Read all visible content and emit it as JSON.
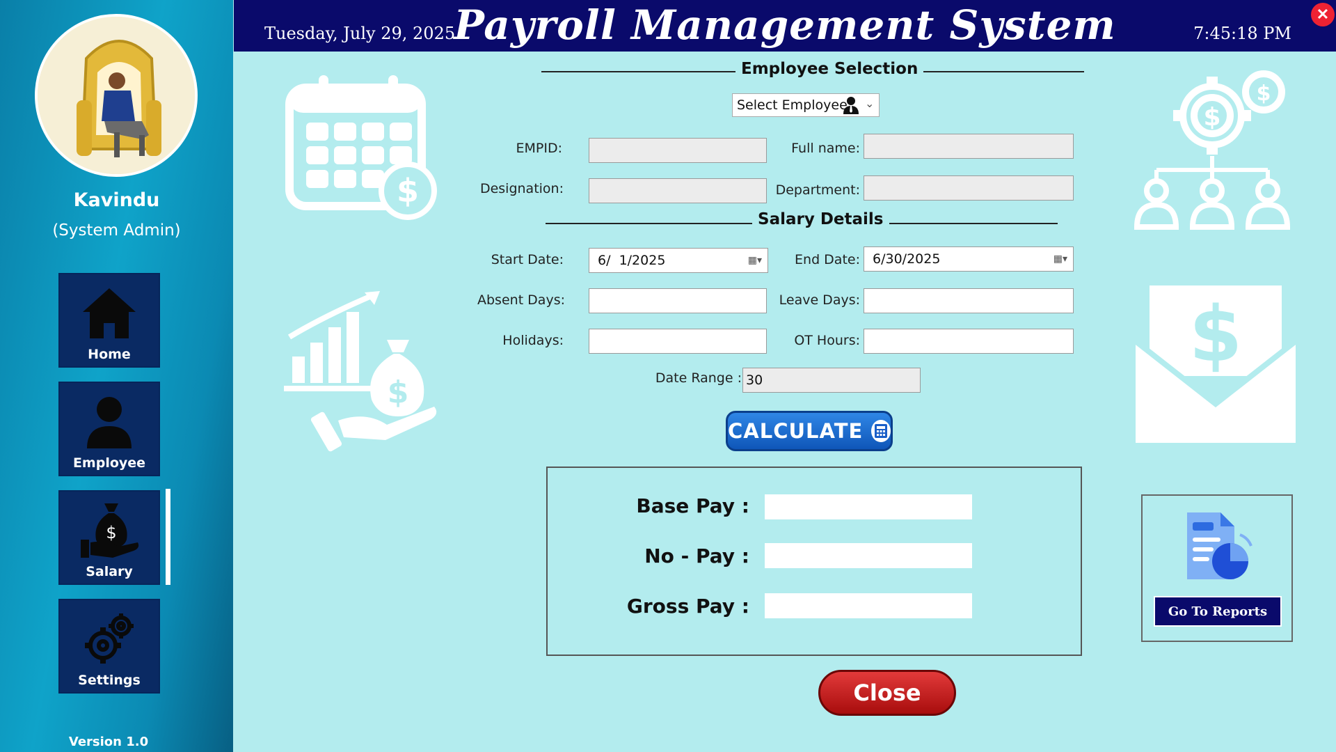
{
  "sidebar": {
    "user_name": "Kavindu",
    "user_role": "(System Admin)",
    "nav": [
      {
        "label": "Home",
        "icon": "home-icon"
      },
      {
        "label": "Employee",
        "icon": "user-icon"
      },
      {
        "label": "Salary",
        "icon": "money-bag-hand-icon"
      },
      {
        "label": "Settings",
        "icon": "gears-icon"
      }
    ],
    "active": "Salary",
    "version": "Version 1.0"
  },
  "header": {
    "date": "Tuesday, July 29, 2025",
    "title": "Payroll Management System",
    "time": "7:45:18 PM"
  },
  "employee_selection": {
    "title": "Employee Selection",
    "select_label": "Select Employee",
    "fields": {
      "empid_label": "EMPID:",
      "empid_value": "",
      "fullname_label": "Full name:",
      "fullname_value": "",
      "designation_label": "Designation:",
      "designation_value": "",
      "department_label": "Department:",
      "department_value": ""
    }
  },
  "salary_details": {
    "title": "Salary Details",
    "start_date_label": "Start Date:",
    "start_date_value": "6/  1/2025",
    "end_date_label": "End Date:",
    "end_date_value": "6/30/2025",
    "absent_label": "Absent Days:",
    "absent_value": "",
    "leave_label": "Leave Days:",
    "leave_value": "",
    "holidays_label": "Holidays:",
    "holidays_value": "",
    "ot_label": "OT Hours:",
    "ot_value": "",
    "range_label": "Date Range :",
    "range_value": "30"
  },
  "buttons": {
    "calculate": "CALCULATE",
    "close": "Close",
    "reports": "Go To Reports"
  },
  "pay": {
    "base_label": "Base Pay :",
    "base_value": "",
    "nopay_label": "No - Pay :",
    "nopay_value": "",
    "gross_label": "Gross Pay :",
    "gross_value": ""
  },
  "colors": {
    "header_bg": "#0a0a6b",
    "main_bg": "#b3ecee",
    "sidebar_accent": "#0fa3c9",
    "calculate_btn": "#1a6ad0",
    "close_btn": "#c21a1a"
  }
}
